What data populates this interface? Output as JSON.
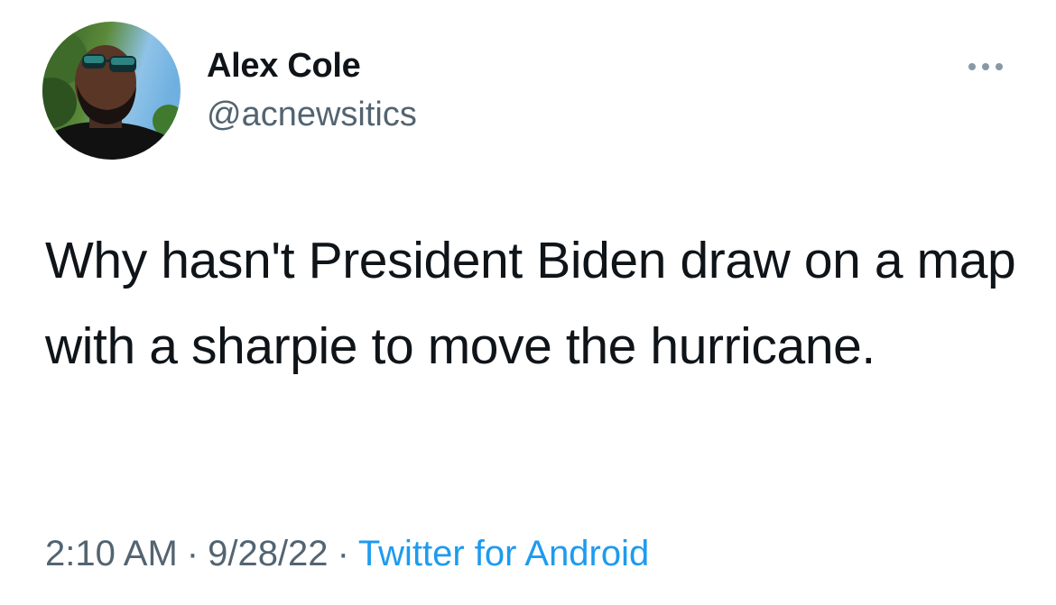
{
  "author": {
    "display_name": "Alex Cole",
    "handle": "@acnewsitics"
  },
  "tweet": {
    "text": "Why hasn't President Biden draw on a map with a sharpie to move the hurricane."
  },
  "meta": {
    "time": "2:10 AM",
    "separator": "·",
    "date": "9/28/22",
    "source": "Twitter for Android"
  },
  "icons": {
    "more": "more-horizontal-icon"
  },
  "colors": {
    "text_primary": "#0f1419",
    "text_secondary": "#536471",
    "link": "#1d9bf0"
  }
}
